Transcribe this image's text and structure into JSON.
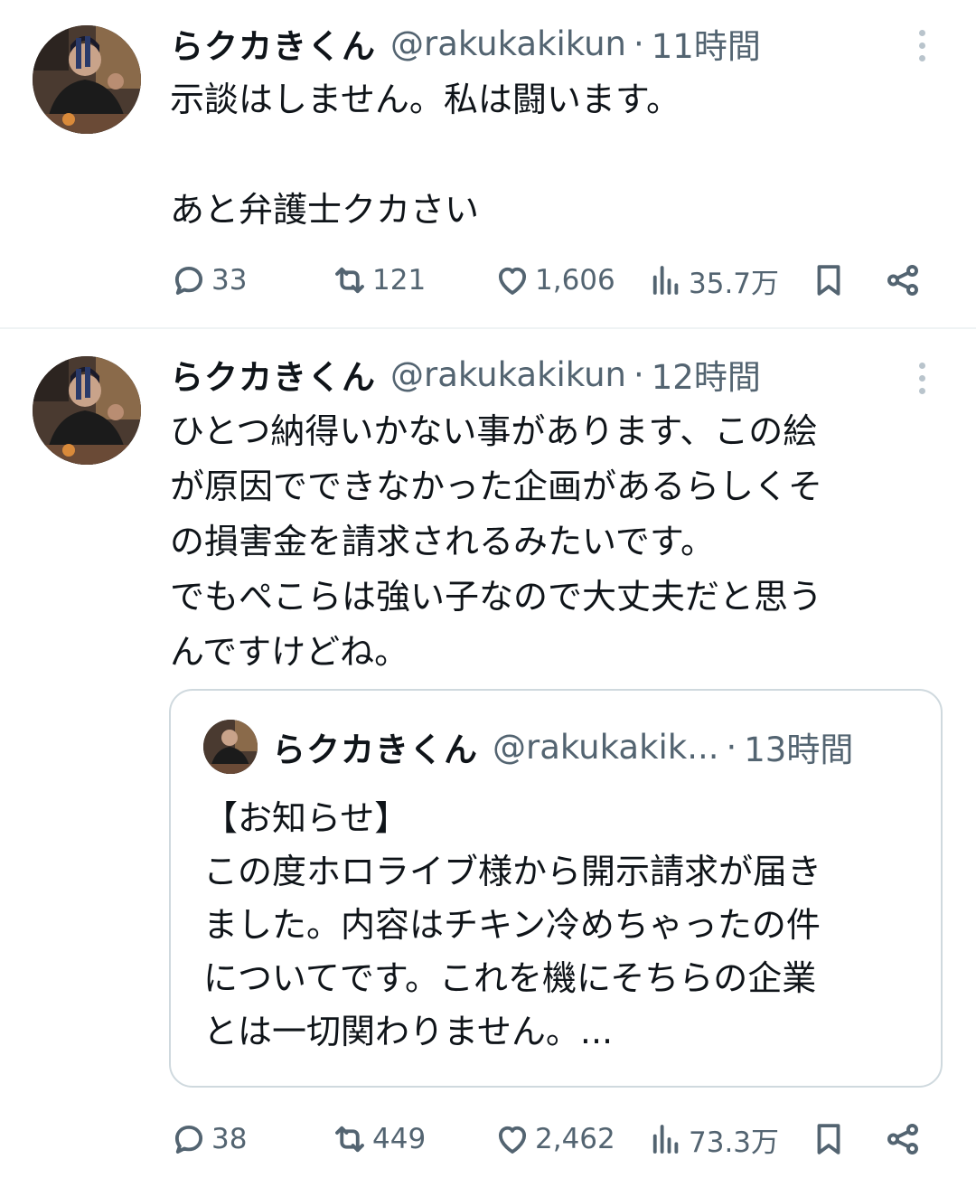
{
  "tweets": [
    {
      "author_name": "らクカきくん",
      "handle": "@rakukakikun",
      "separator": "·",
      "time": "11時間",
      "text_lines": [
        "示談はしません。私は闘います。",
        "",
        "あと弁護士クカさい"
      ],
      "replies": "33",
      "retweets": "121",
      "likes": "1,606",
      "views": "35.7万"
    },
    {
      "author_name": "らクカきくん",
      "handle": "@rakukakikun",
      "separator": "·",
      "time": "12時間",
      "text_lines": [
        "ひとつ納得いかない事があります、この絵",
        "が原因でできなかった企画があるらしくそ",
        "の損害金を請求されるみたいです。",
        "でもぺこらは強い子なので大丈夫だと思う",
        "んですけどね。"
      ],
      "quote": {
        "author_name": "らクカきくん",
        "handle": "@rakukakik...",
        "separator": "·",
        "time": "13時間",
        "text_lines": [
          "【お知らせ】",
          "この度ホロライブ様から開示請求が届き",
          "ました。内容はチキン冷めちゃったの件",
          "についてです。これを機にそちらの企業",
          "とは一切関わりません。..."
        ]
      },
      "replies": "38",
      "retweets": "449",
      "likes": "2,462",
      "views": "73.3万"
    }
  ],
  "icons": {
    "reply": "reply-icon",
    "retweet": "retweet-icon",
    "like": "heart-icon",
    "views": "views-chart-icon",
    "bookmark": "bookmark-icon",
    "share": "share-icon",
    "more": "more-dots-icon"
  },
  "colors": {
    "text_primary": "#0f1419",
    "text_secondary": "#536471",
    "border": "#cfd9de"
  }
}
